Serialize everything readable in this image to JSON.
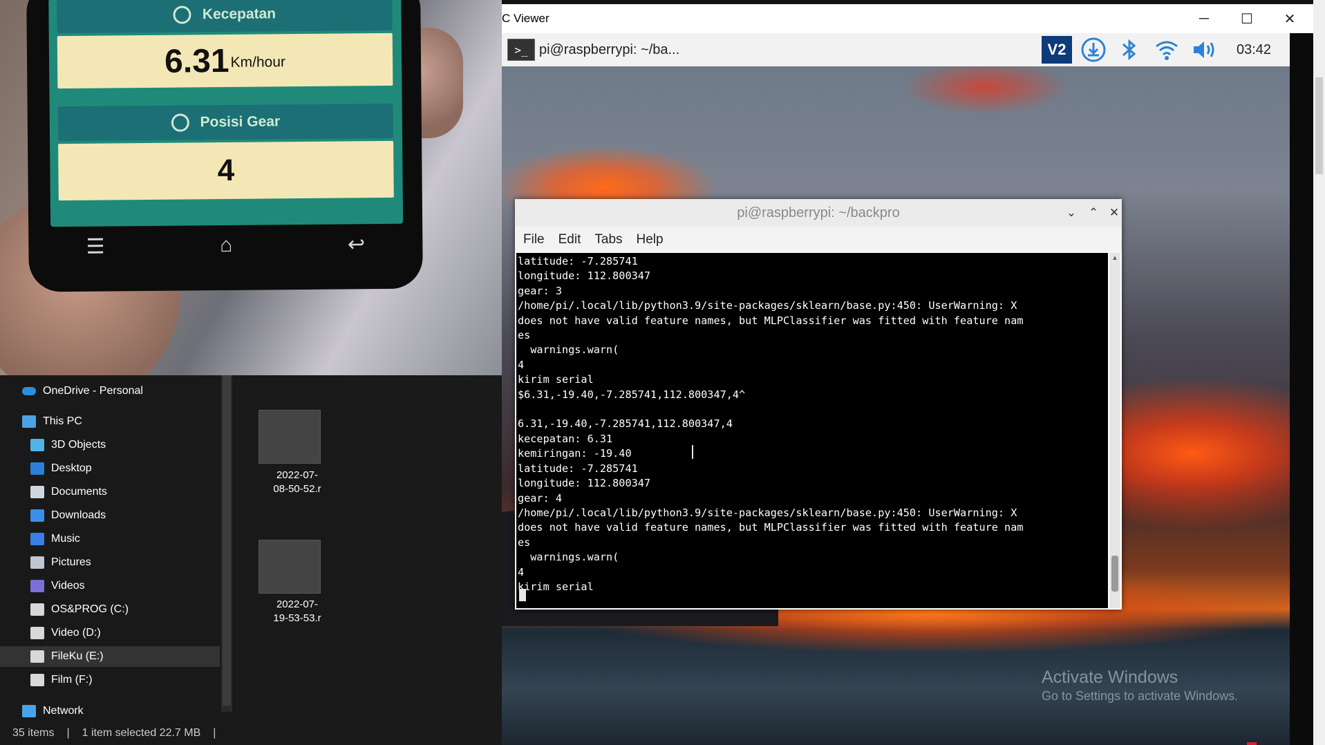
{
  "phone_app": {
    "speed_label": "Kecepatan",
    "speed_value": "6.31",
    "speed_unit": "Km/hour",
    "gear_label": "Posisi Gear",
    "gear_value": "4",
    "nav_icons": [
      "menu-icon",
      "home-icon",
      "back-icon"
    ]
  },
  "explorer": {
    "nav_items": [
      {
        "label": "OneDrive - Personal",
        "icon": "onedrive-icon",
        "color": "#2a8fe0"
      },
      {
        "label": "This PC",
        "icon": "this-pc-icon",
        "color": "#4aa3e8"
      },
      {
        "label": "3D Objects",
        "icon": "3d-objects-icon",
        "color": "#4fb4e8"
      },
      {
        "label": "Desktop",
        "icon": "desktop-icon",
        "color": "#2b7fd8"
      },
      {
        "label": "Documents",
        "icon": "documents-icon",
        "color": "#cfd6df"
      },
      {
        "label": "Downloads",
        "icon": "downloads-icon",
        "color": "#3c8fe6"
      },
      {
        "label": "Music",
        "icon": "music-icon",
        "color": "#3a7fe6"
      },
      {
        "label": "Pictures",
        "icon": "pictures-icon",
        "color": "#bfc7d1"
      },
      {
        "label": "Videos",
        "icon": "videos-icon",
        "color": "#7b6fd9"
      },
      {
        "label": "OS&PROG (C:)",
        "icon": "drive-icon",
        "color": "#d8d8d8"
      },
      {
        "label": "Video (D:)",
        "icon": "drive-icon",
        "color": "#d8d8d8"
      },
      {
        "label": "FileKu (E:)",
        "icon": "drive-icon",
        "color": "#d8d8d8"
      },
      {
        "label": "Film (F:)",
        "icon": "drive-icon",
        "color": "#d8d8d8"
      },
      {
        "label": "Network",
        "icon": "network-icon",
        "color": "#4aa3e8"
      }
    ],
    "files": [
      {
        "label": "2022-07-\n08-50-52.r"
      },
      {
        "label": "2022-07-\n19-53-53.r"
      }
    ],
    "status": {
      "items": "35 items",
      "selected": "1 item selected  22.7 MB"
    }
  },
  "vnc": {
    "window_title": "C Viewer",
    "taskbar_item": "pi@raspberrypi: ~/ba...",
    "clock": "03:42",
    "tray_icons": [
      "vnc-icon",
      "updater-icon",
      "bluetooth-icon",
      "wifi-icon",
      "volume-icon"
    ],
    "watermark_title": "Activate Windows",
    "watermark_sub": "Go to Settings to activate Windows."
  },
  "terminal": {
    "title": "pi@raspberrypi: ~/backpro",
    "menu": [
      "File",
      "Edit",
      "Tabs",
      "Help"
    ],
    "lines": [
      "latitude: -7.285741",
      "longitude: 112.800347",
      "gear: 3",
      "/home/pi/.local/lib/python3.9/site-packages/sklearn/base.py:450: UserWarning: X",
      "does not have valid feature names, but MLPClassifier was fitted with feature nam",
      "es",
      "  warnings.warn(",
      "4",
      "kirim serial",
      "$6.31,-19.40,-7.285741,112.800347,4^",
      "",
      "6.31,-19.40,-7.285741,112.800347,4",
      "kecepatan: 6.31",
      "kemiringan: -19.40",
      "latitude: -7.285741",
      "longitude: 112.800347",
      "gear: 4",
      "/home/pi/.local/lib/python3.9/site-packages/sklearn/base.py:450: UserWarning: X",
      "does not have valid feature names, but MLPClassifier was fitted with feature nam",
      "es",
      "  warnings.warn(",
      "4",
      "kirim serial"
    ]
  }
}
